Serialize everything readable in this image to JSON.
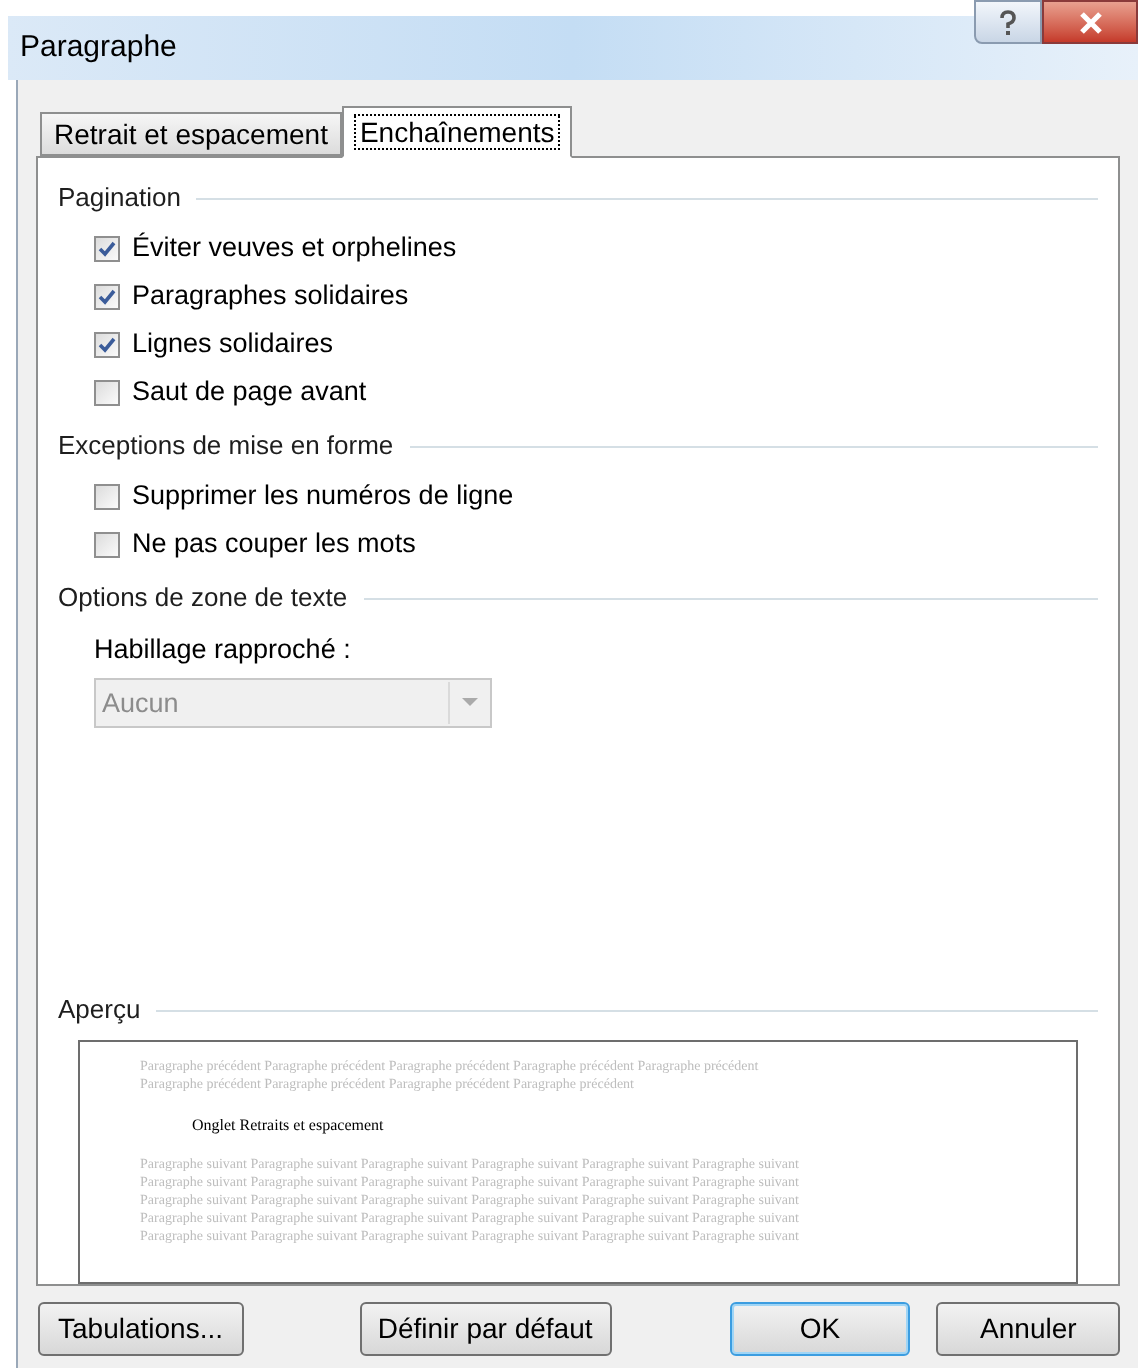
{
  "window": {
    "title": "Paragraphe"
  },
  "tabs": [
    {
      "label": "Retrait et espacement",
      "selected": false
    },
    {
      "label": "Enchaînements",
      "selected": true
    }
  ],
  "sections": [
    {
      "title": "Pagination",
      "items": [
        {
          "kind": "checkbox",
          "label": "Éviter veuves et orphelines",
          "checked": true
        },
        {
          "kind": "checkbox",
          "label": "Paragraphes solidaires",
          "checked": true
        },
        {
          "kind": "checkbox",
          "label": "Lignes solidaires",
          "checked": true
        },
        {
          "kind": "checkbox",
          "label": "Saut de page avant",
          "checked": false
        }
      ]
    },
    {
      "title": "Exceptions de mise en forme",
      "items": [
        {
          "kind": "checkbox",
          "label": "Supprimer les numéros de ligne",
          "checked": false
        },
        {
          "kind": "checkbox",
          "label": "Ne pas couper les mots",
          "checked": false
        }
      ]
    },
    {
      "title": "Options de zone de texte",
      "items": [
        {
          "kind": "dropdown",
          "label": "Habillage rapproché :",
          "value": "Aucun",
          "disabled": true
        }
      ]
    }
  ],
  "preview": {
    "title": "Aperçu",
    "previous_lines": [
      "Paragraphe précédent Paragraphe précédent Paragraphe précédent Paragraphe précédent Paragraphe précédent",
      "Paragraphe précédent Paragraphe précédent Paragraphe précédent Paragraphe précédent"
    ],
    "sample": "Onglet Retraits et espacement",
    "following_lines": [
      "Paragraphe suivant Paragraphe suivant Paragraphe suivant Paragraphe suivant Paragraphe suivant Paragraphe suivant",
      "Paragraphe suivant Paragraphe suivant Paragraphe suivant Paragraphe suivant Paragraphe suivant Paragraphe suivant",
      "Paragraphe suivant Paragraphe suivant Paragraphe suivant Paragraphe suivant Paragraphe suivant Paragraphe suivant",
      "Paragraphe suivant Paragraphe suivant Paragraphe suivant Paragraphe suivant Paragraphe suivant Paragraphe suivant",
      "Paragraphe suivant Paragraphe suivant Paragraphe suivant Paragraphe suivant Paragraphe suivant Paragraphe suivant"
    ]
  },
  "buttons": [
    {
      "label": "Tabulations...",
      "kind": "normal"
    },
    {
      "label": "Définir par défaut",
      "kind": "normal"
    },
    {
      "label": "OK",
      "kind": "default"
    },
    {
      "label": "Annuler",
      "kind": "normal"
    }
  ]
}
